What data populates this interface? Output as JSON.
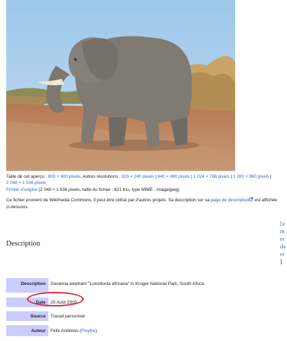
{
  "image_info": {
    "preview_label": "Taille de cet aperçu :",
    "preview_size": "800 × 600 pixels",
    "other_res_label": ". Autres résolutions :",
    "resolutions": [
      "320 × 240 pixels",
      "640 × 480 pixels",
      "1 024 × 768 pixels",
      "1 280 × 960 pixels",
      "2 048 × 1 536 pixels"
    ],
    "separator": " | ",
    "original_link": "Fichier d’origine",
    "original_details": " (2 048 × 1 536 pixels, taille du fichier : 821 Kio, type MIME : image/jpeg)"
  },
  "commons_notice": {
    "text_before": "Ce fichier provient de Wikimedia Commons. Il peut être utilisé par d'autres projets. Sa description sur sa ",
    "link": "page de description",
    "external_icon": "external-link-icon",
    "text_after": " est affichée",
    "text_line2": "ci-dessous."
  },
  "description_heading": "Description",
  "edit_links": [
    "[a",
    "m",
    "er",
    "da",
    "er",
    "]"
  ],
  "info_table": {
    "description_label": "Description",
    "description_value": "Savanna elephant \"Loxodonta africana\" in Kruger National Park, South Africa.",
    "date_label": "Date",
    "date_value": "20 Août 2005",
    "source_label": "Source",
    "source_value": "Travail personnel",
    "author_label": "Auteur",
    "author_name": "Felix Andrews",
    "author_paren_open": " (",
    "author_link": "Floybix",
    "author_paren_close": ")"
  },
  "colors": {
    "link": "#3366cc",
    "table_label_bg": "#ccccff",
    "highlight_circle": "#e0202a"
  }
}
